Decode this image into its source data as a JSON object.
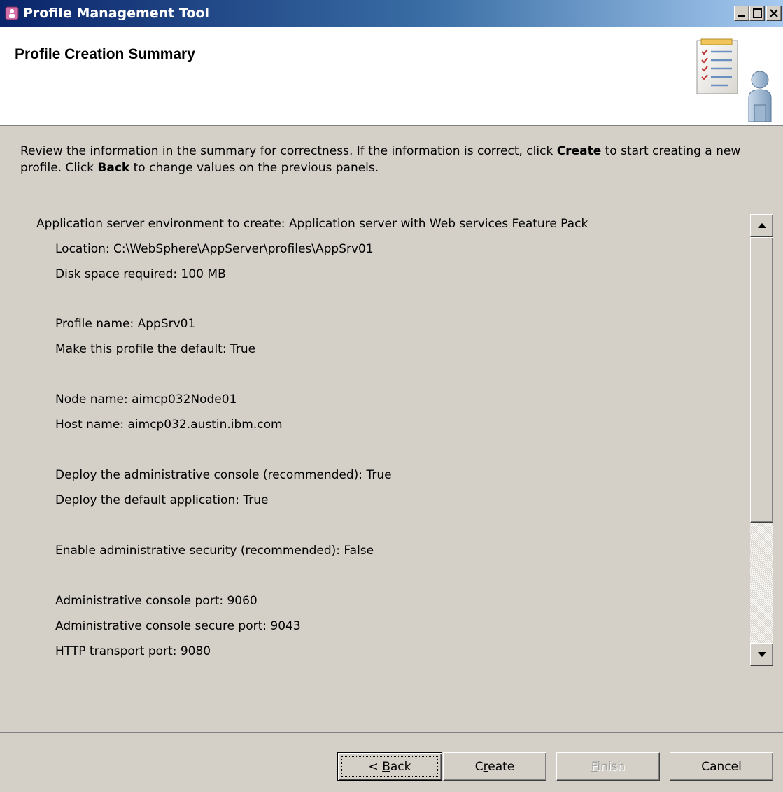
{
  "window": {
    "title": "Profile Management Tool"
  },
  "header": {
    "title": "Profile Creation Summary"
  },
  "intro": {
    "part1": "Review the information in the summary for correctness. If the information is correct, click ",
    "create_word": "Create",
    "part2": " to start creating a new profile. Click ",
    "back_word": "Back",
    "part3": " to change values on the previous panels."
  },
  "summary": {
    "environment": "Application server environment to create: Application server with Web services Feature Pack",
    "location": "Location: C:\\WebSphere\\AppServer\\profiles\\AppSrv01",
    "disk_space": "Disk space required: 100 MB",
    "profile_name": "Profile name: AppSrv01",
    "make_default": "Make this profile the default: True",
    "node_name": "Node name: aimcp032Node01",
    "host_name": "Host name: aimcp032.austin.ibm.com",
    "deploy_console": "Deploy the administrative console (recommended): True",
    "deploy_default_app": "Deploy the default application: True",
    "admin_security": "Enable administrative security (recommended): False",
    "console_port": "Administrative console port: 9060",
    "console_secure_port": "Administrative console secure port: 9043",
    "http_port": "HTTP transport port: 9080"
  },
  "buttons": {
    "back_prefix": "< ",
    "back_mnemonic": "B",
    "back_rest": "ack",
    "create_first": "C",
    "create_mnemonic": "r",
    "create_rest": "eate",
    "finish_mnemonic": "F",
    "finish_rest": "inish",
    "cancel": "Cancel"
  },
  "icons": {
    "app": "profile-tool-icon",
    "banner": "checklist-person-icon"
  }
}
